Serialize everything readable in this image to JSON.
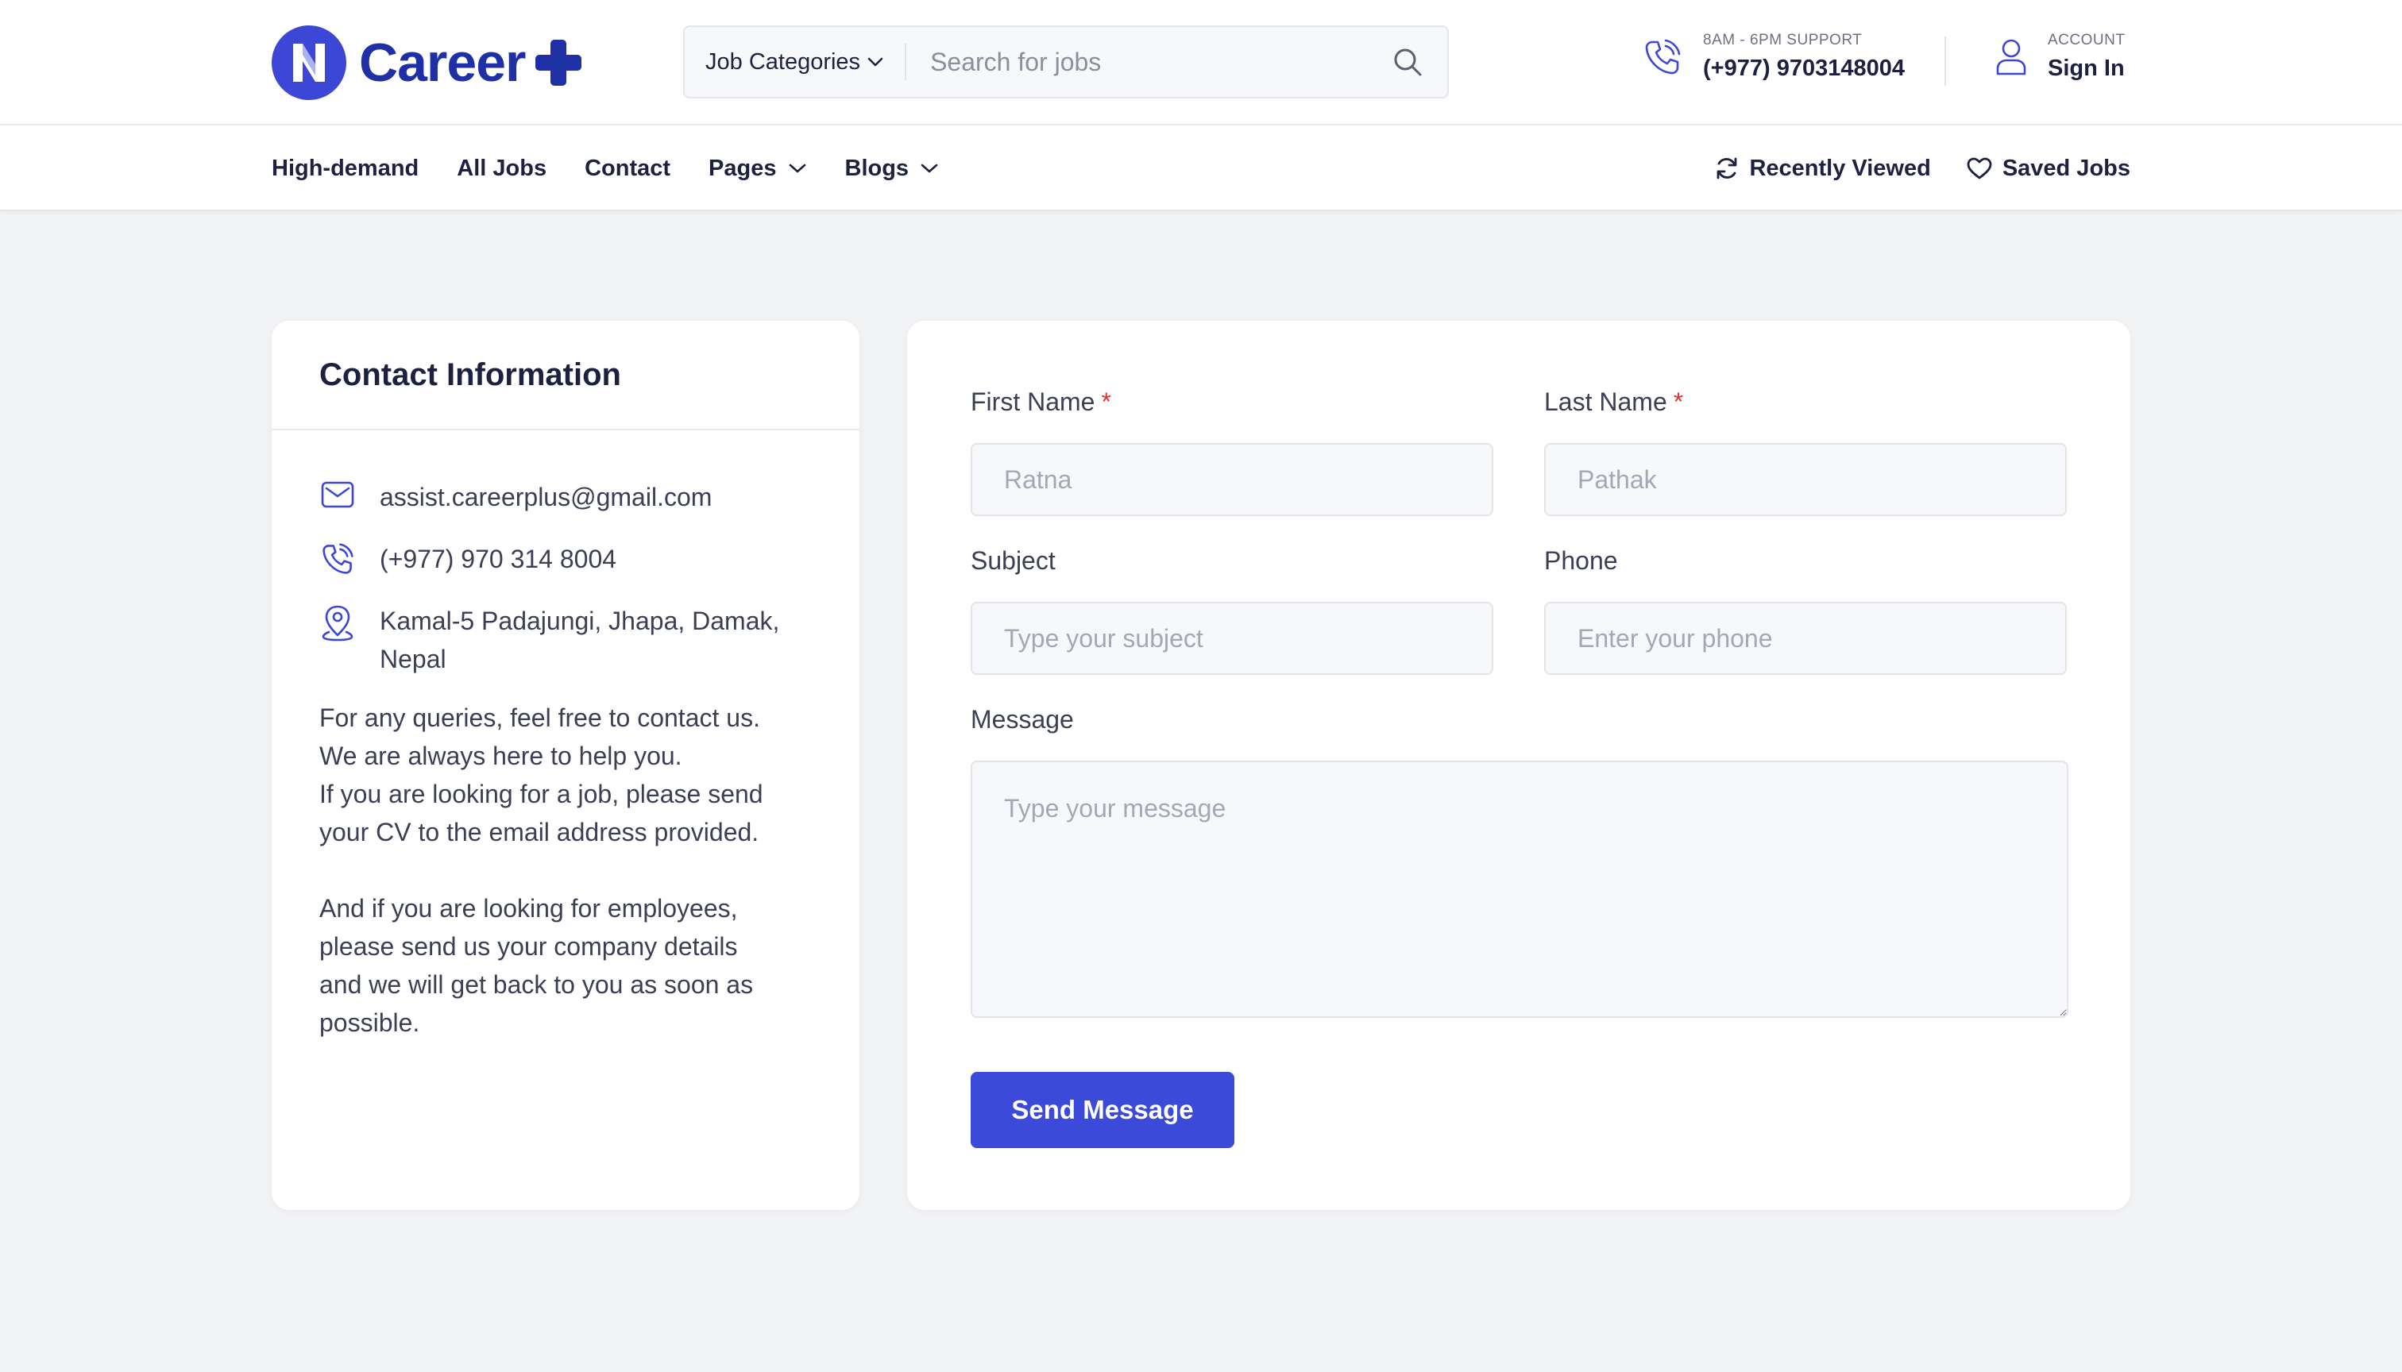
{
  "header": {
    "logo_text": "Career",
    "search": {
      "category_label": "Job Categories",
      "placeholder": "Search for jobs"
    },
    "support": {
      "caption": "8AM - 6PM SUPPORT",
      "phone": "(+977) 9703148004"
    },
    "account": {
      "caption": "ACCOUNT",
      "label": "Sign In"
    }
  },
  "nav": {
    "items": [
      {
        "label": "High-demand"
      },
      {
        "label": "All Jobs"
      },
      {
        "label": "Contact"
      },
      {
        "label": "Pages"
      },
      {
        "label": "Blogs"
      }
    ],
    "recently_viewed": "Recently Viewed",
    "saved_jobs": "Saved Jobs"
  },
  "contact_info": {
    "title": "Contact Information",
    "email": "assist.careerplus@gmail.com",
    "phone": "(+977) 970 314 8004",
    "address_line1": "Kamal-5 Padajungi, Jhapa, Damak,",
    "address_line2": "Nepal",
    "para1_line1": "For any queries, feel free to contact us.",
    "para1_line2": "We are always here to help you.",
    "para1_line3": "If you are looking for a job, please send",
    "para1_line4": "your CV to the email address provided.",
    "para2_line1": "And if you are looking for employees,",
    "para2_line2": "please send us your company details",
    "para2_line3": "and we will get back to you as soon as",
    "para2_line4": "possible."
  },
  "form": {
    "first_name": {
      "label": "First Name",
      "required": "*",
      "placeholder": "Ratna"
    },
    "last_name": {
      "label": "Last Name",
      "required": "*",
      "placeholder": "Pathak"
    },
    "subject": {
      "label": "Subject",
      "placeholder": "Type your subject"
    },
    "phone": {
      "label": "Phone",
      "placeholder": "Enter your phone"
    },
    "message": {
      "label": "Message",
      "placeholder": "Type your message"
    },
    "submit_label": "Send Message"
  },
  "colors": {
    "brand": "#3c47d6",
    "brand_dark": "#1f2fa5",
    "button": "#3b4ad8",
    "required": "#e0332d"
  },
  "icons": {
    "logo": "n-logo-icon",
    "search": "search-icon",
    "phone": "phone-icon",
    "user": "user-icon",
    "refresh": "refresh-icon",
    "heart": "heart-icon",
    "mail": "mail-icon",
    "location": "location-pin-icon"
  }
}
